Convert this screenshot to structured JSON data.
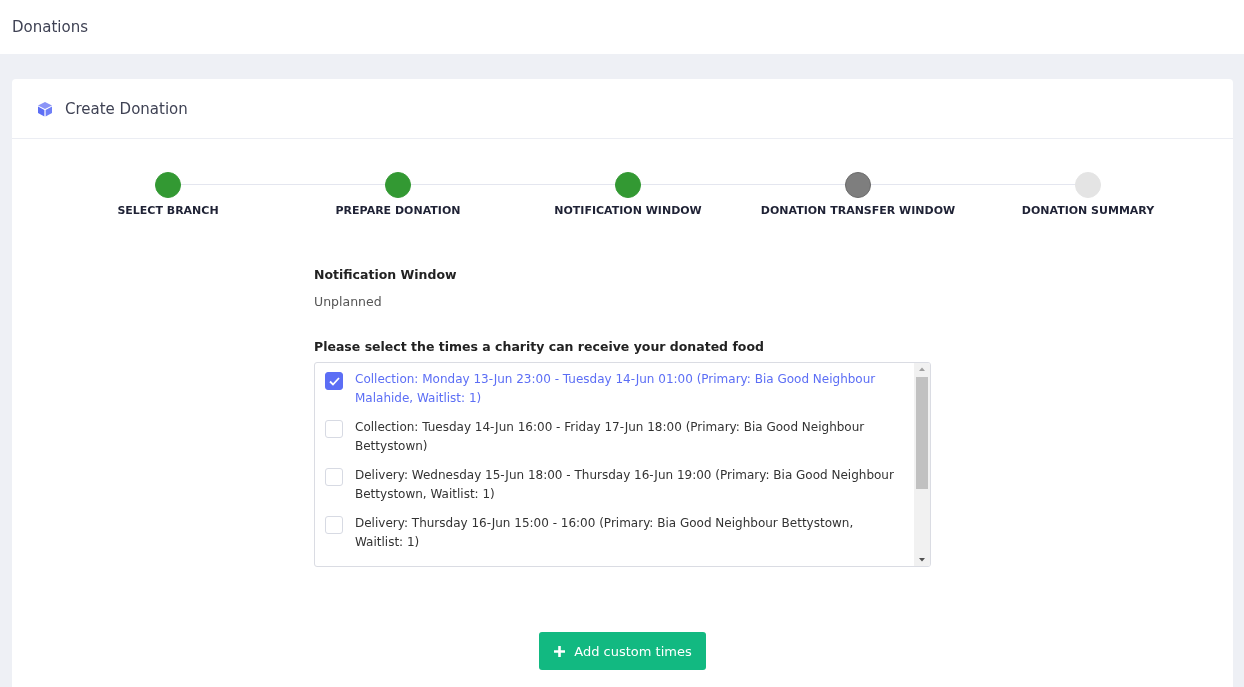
{
  "page_title": "Donations",
  "card": {
    "title": "Create Donation"
  },
  "steps": [
    {
      "label": "SELECT BRANCH",
      "completed": true,
      "selected": false
    },
    {
      "label": "PREPARE DONATION",
      "completed": true,
      "selected": false
    },
    {
      "label": "NOTIFICATION WINDOW",
      "completed": true,
      "selected": false
    },
    {
      "label": "DONATION TRANSFER WINDOW",
      "completed": false,
      "selected": true
    },
    {
      "label": "DONATION SUMMARY",
      "completed": false,
      "selected": false
    }
  ],
  "section": {
    "title": "Notification Window",
    "value": "Unplanned"
  },
  "times": {
    "prompt": "Please select the times a charity can receive your donated food",
    "options": [
      {
        "label": "Collection: Monday 13-Jun 23:00 - Tuesday 14-Jun 01:00 (Primary: Bia Good Neighbour Malahide, Waitlist: 1)",
        "checked": true
      },
      {
        "label": "Collection: Tuesday 14-Jun 16:00 - Friday 17-Jun 18:00 (Primary: Bia Good Neighbour Bettystown)",
        "checked": false
      },
      {
        "label": "Delivery: Wednesday 15-Jun 18:00 - Thursday 16-Jun 19:00 (Primary: Bia Good Neighbour Bettystown, Waitlist: 1)",
        "checked": false
      },
      {
        "label": "Delivery: Thursday 16-Jun 15:00 - 16:00 (Primary: Bia Good Neighbour Bettystown, Waitlist: 1)",
        "checked": false
      }
    ]
  },
  "add_button": {
    "label": "Add custom times"
  }
}
